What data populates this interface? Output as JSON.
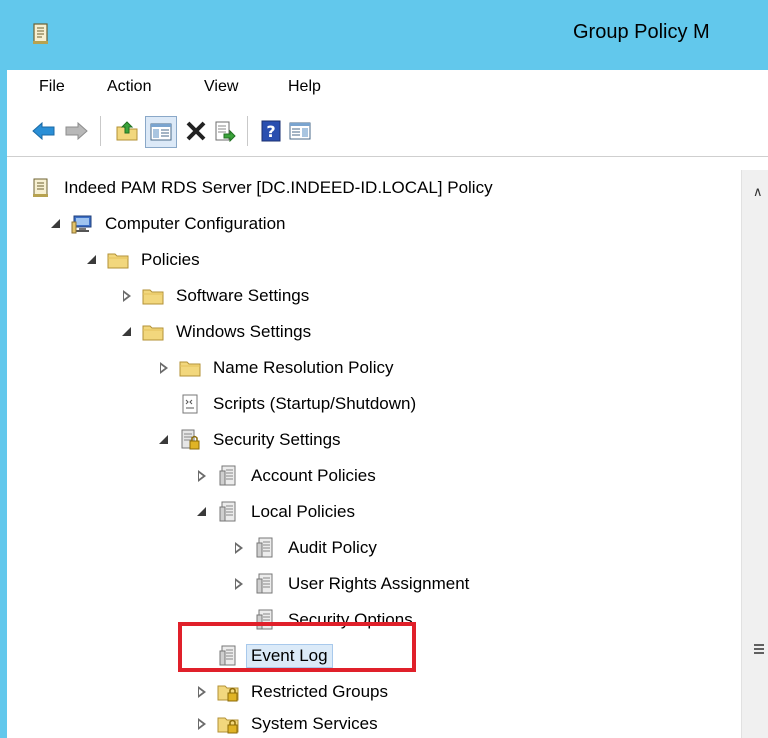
{
  "window": {
    "title": "Group Policy M"
  },
  "menu": {
    "file": "File",
    "action": "Action",
    "view": "View",
    "help": "Help"
  },
  "toolbar": {
    "buttons": [
      "back-icon",
      "forward-icon",
      "up-folder-icon",
      "show-hide-tree-icon",
      "delete-icon",
      "export-list-icon",
      "help-icon",
      "show-hide-action-pane-icon"
    ]
  },
  "tree": {
    "root": "Indeed PAM RDS Server [DC.INDEED-ID.LOCAL] Policy",
    "computer_configuration": "Computer Configuration",
    "policies": "Policies",
    "software_settings": "Software Settings",
    "windows_settings": "Windows Settings",
    "name_resolution_policy": "Name Resolution Policy",
    "scripts": "Scripts (Startup/Shutdown)",
    "security_settings": "Security Settings",
    "account_policies": "Account Policies",
    "local_policies": "Local Policies",
    "audit_policy": "Audit Policy",
    "user_rights_assignment": "User Rights Assignment",
    "security_options": "Security Options",
    "event_log": "Event Log",
    "restricted_groups": "Restricted Groups",
    "system_services": "System Services"
  },
  "colors": {
    "titlebar": "#62c8ec",
    "highlight": "#e0202a",
    "folder": "#f2d77d"
  }
}
